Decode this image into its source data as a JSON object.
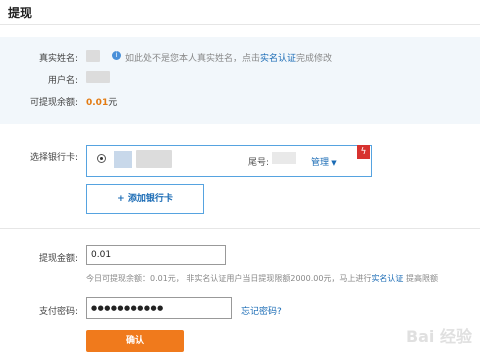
{
  "header": {
    "title": "提现"
  },
  "info": {
    "real_name_label": "真实姓名:",
    "real_name_note_prefix": "如此处不是您本人真实姓名，点击",
    "real_name_note_link": "实名认证",
    "real_name_note_suffix": "完成修改",
    "username_label": "用户名:",
    "balance_label": "可提现余额:",
    "balance_value": "0.01",
    "balance_unit": "元"
  },
  "bank": {
    "select_label": "选择银行卡:",
    "tail_label": "尾号:",
    "manage_label": "管理",
    "add_card_label": "+ 添加银行卡",
    "flag_icon": "lightning-icon"
  },
  "form": {
    "amount_label": "提现金额:",
    "amount_value": "0.01",
    "limit_hint_prefix": "今日可提现余额：0.01元，  非实名认证用户当日提现限额2000.00元，马上进行",
    "limit_hint_link": "实名认证",
    "limit_hint_suffix": "提高限额",
    "password_label": "支付密码:",
    "password_value": "●●●●●●●●●●●",
    "forgot_link": "忘记密码?",
    "confirm_label": "确认"
  },
  "watermark": "Bai 经验"
}
